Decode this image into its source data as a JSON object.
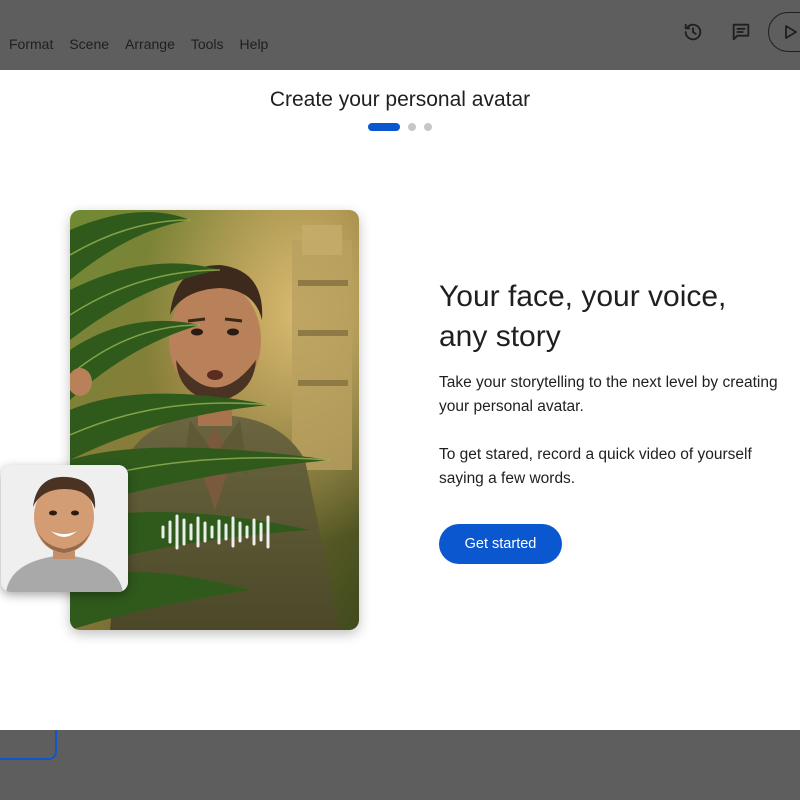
{
  "menu": {
    "items": [
      "Format",
      "Scene",
      "Arrange",
      "Tools",
      "Help"
    ]
  },
  "toolbar": {
    "icons": [
      "history-icon",
      "comment-icon",
      "play-icon"
    ]
  },
  "dialog": {
    "title": "Create your personal avatar",
    "steps": {
      "total": 3,
      "current": 1
    },
    "headline": "Your face, your voice, any story",
    "paragraph1": "Take your storytelling to the next level by creating your personal avatar.",
    "paragraph2": "To get stared, record a quick video of yourself saying a few words.",
    "cta_label": "Get started"
  },
  "colors": {
    "accent": "#0b57d0",
    "overlay": "#5e5e5e",
    "text": "#1f1f1f"
  }
}
